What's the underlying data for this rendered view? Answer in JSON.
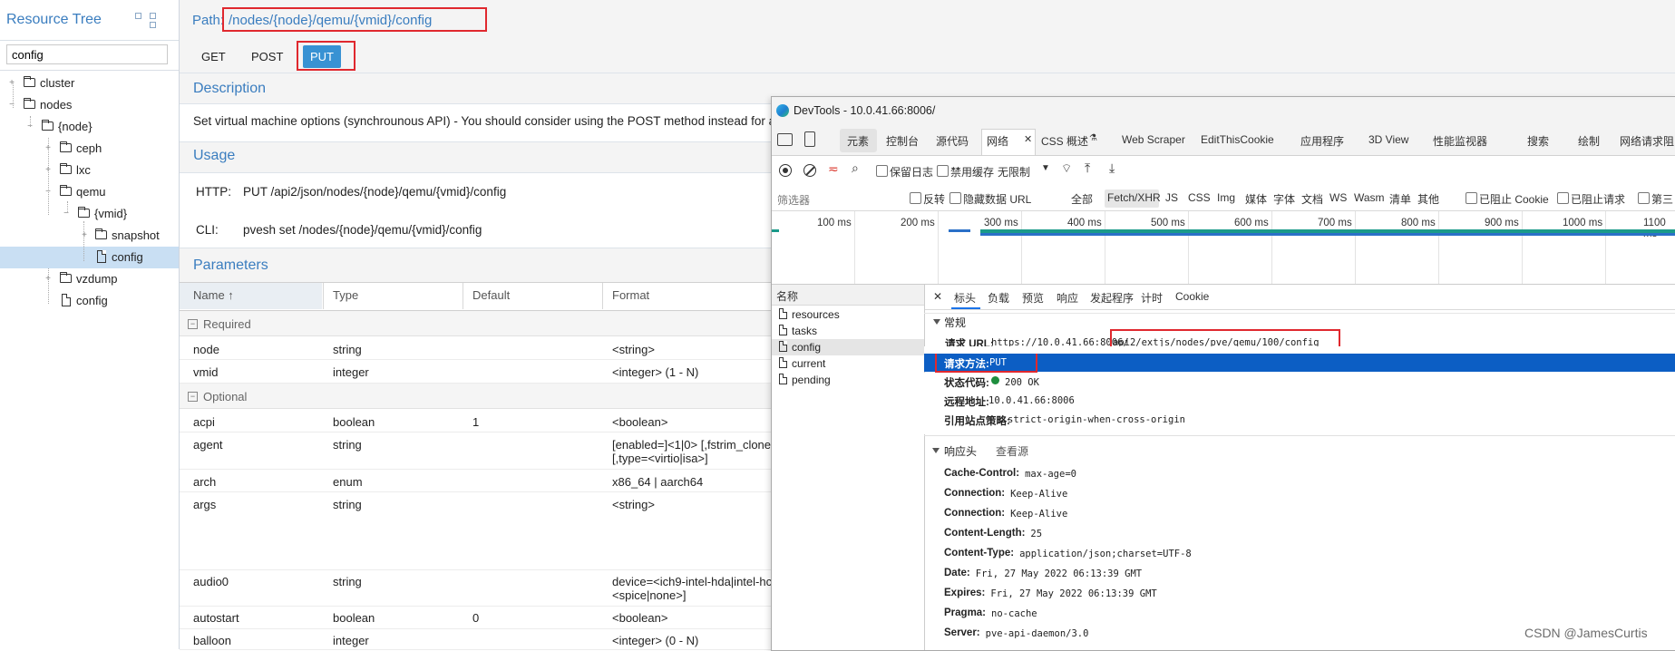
{
  "tree": {
    "title": "Resource Tree",
    "search_value": "config",
    "nodes": [
      "cluster",
      "nodes",
      "{node}",
      "ceph",
      "lxc",
      "qemu",
      "{vmid}",
      "snapshot",
      "config",
      "vzdump",
      "config"
    ]
  },
  "api": {
    "path_label": "Path:",
    "path_value": "/nodes/{node}/qemu/{vmid}/config",
    "methods": [
      "GET",
      "POST",
      "PUT"
    ],
    "description_title": "Description",
    "description": "Set virtual machine options (synchrounous API) - You should consider using the POST method instead for any",
    "usage_title": "Usage",
    "usage": {
      "http_label": "HTTP:",
      "http_value": "PUT /api2/json/nodes/{node}/qemu/{vmid}/config",
      "cli_label": "CLI:",
      "cli_value": "pvesh set /nodes/{node}/qemu/{vmid}/config"
    },
    "parameters_title": "Parameters",
    "columns": [
      "Name ↑",
      "Type",
      "Default",
      "Format"
    ],
    "groups": {
      "required": "Required",
      "optional": "Optional"
    },
    "rows": [
      {
        "name": "node",
        "type": "string",
        "default": "",
        "format": "<string>"
      },
      {
        "name": "vmid",
        "type": "integer",
        "default": "",
        "format": "<integer> (1 - N)"
      },
      {
        "name": "acpi",
        "type": "boolean",
        "default": "1",
        "format": "<boolean>"
      },
      {
        "name": "agent",
        "type": "string",
        "default": "",
        "format": "[enabled=]<1|0> [,fstrim_clone",
        "format2": "[,type=<virtio|isa>]"
      },
      {
        "name": "arch",
        "type": "enum",
        "default": "",
        "format": "x86_64 | aarch64"
      },
      {
        "name": "args",
        "type": "string",
        "default": "",
        "format": "<string>"
      },
      {
        "name": "audio0",
        "type": "string",
        "default": "",
        "format": "device=<ich9-intel-hda|intel-hc",
        "format2": "<spice|none>]"
      },
      {
        "name": "autostart",
        "type": "boolean",
        "default": "0",
        "format": "<boolean>"
      },
      {
        "name": "balloon",
        "type": "integer",
        "default": "",
        "format": "<integer> (0 - N)"
      }
    ]
  },
  "devtools": {
    "title": "DevTools - 10.0.41.66:8006/",
    "tabs": [
      "元素",
      "控制台",
      "源代码",
      "网络",
      "CSS 概述",
      "Web Scraper",
      "EditThisCookie",
      "应用程序",
      "3D View",
      "性能监视器",
      "搜索",
      "绘制",
      "网络请求阻"
    ],
    "toolbar": {
      "preserve_log": "保留日志",
      "disable_cache": "禁用缓存",
      "throttle": "无限制"
    },
    "filter": {
      "placeholder": "筛选器",
      "invert": "反转",
      "hide_data_urls": "隐藏数据 URL",
      "types": [
        "全部",
        "Fetch/XHR",
        "JS",
        "CSS",
        "Img",
        "媒体",
        "字体",
        "文档",
        "WS",
        "Wasm",
        "清单",
        "其他"
      ],
      "blocked_cookies": "已阻止 Cookie",
      "blocked_requests": "已阻止请求",
      "third_party": "第三"
    },
    "timeline": [
      "100 ms",
      "200 ms",
      "300 ms",
      "400 ms",
      "500 ms",
      "600 ms",
      "700 ms",
      "800 ms",
      "900 ms",
      "1000 ms",
      "1100 ms"
    ],
    "names_header": "名称",
    "requests": [
      "resources",
      "tasks",
      "config",
      "current",
      "pending"
    ],
    "detail_tabs": [
      "标头",
      "负载",
      "预览",
      "响应",
      "发起程序",
      "计时",
      "Cookie"
    ],
    "general": {
      "title": "常规",
      "url_key": "请求 URL:",
      "url_host": "https://10.0.41.66:8006/",
      "url_path": "api2/extjs/nodes/pve/qemu/100/config",
      "method_key": "请求方法:",
      "method_value": "PUT",
      "status_key": "状态代码:",
      "status_value": "200 OK",
      "remote_key": "远程地址:",
      "remote_value": "10.0.41.66:8006",
      "referrer_key": "引用站点策略:",
      "referrer_value": "strict-origin-when-cross-origin"
    },
    "response_headers": {
      "title": "响应头",
      "view_source": "查看源",
      "items": [
        {
          "k": "Cache-Control:",
          "v": "max-age=0"
        },
        {
          "k": "Connection:",
          "v": "Keep-Alive"
        },
        {
          "k": "Connection:",
          "v": "Keep-Alive"
        },
        {
          "k": "Content-Length:",
          "v": "25"
        },
        {
          "k": "Content-Type:",
          "v": "application/json;charset=UTF-8"
        },
        {
          "k": "Date:",
          "v": "Fri, 27 May 2022 06:13:39 GMT"
        },
        {
          "k": "Expires:",
          "v": "Fri, 27 May 2022 06:13:39 GMT"
        },
        {
          "k": "Pragma:",
          "v": "no-cache"
        },
        {
          "k": "Server:",
          "v": "pve-api-daemon/3.0"
        }
      ]
    }
  },
  "watermark": "CSDN @JamesCurtis",
  "colors": {
    "accent": "#3a7dbf",
    "put_button": "#3892d3",
    "highlight": "#e0282e",
    "selected_row": "#0c5ec4"
  }
}
